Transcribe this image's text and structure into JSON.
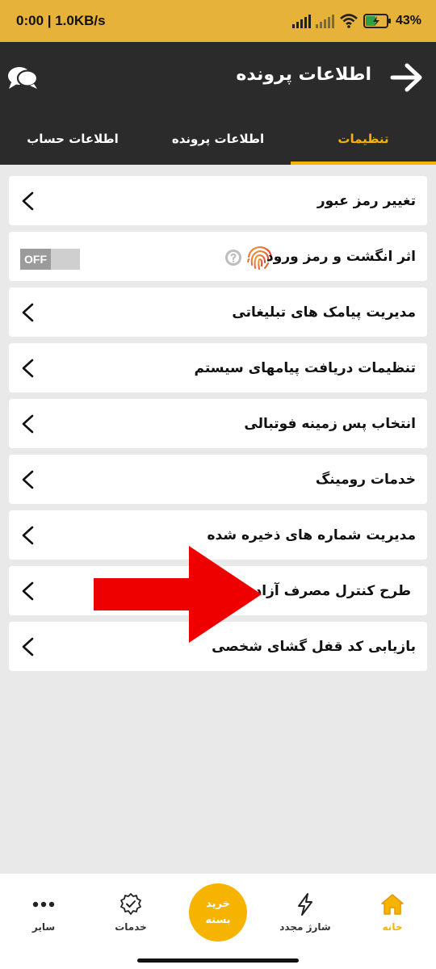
{
  "status_bar": {
    "time_speed": "0:00 | 1.0KB/s",
    "battery": "43%"
  },
  "app_bar": {
    "title": "اطلاعات پرونده"
  },
  "tabs": [
    {
      "label": "تنظیمات",
      "active": true
    },
    {
      "label": "اطلاعات پرونده",
      "active": false
    },
    {
      "label": "اطلاعات حساب",
      "active": false
    }
  ],
  "settings": {
    "items": [
      {
        "label": "تغییر رمز عبور"
      },
      {
        "label": "اثر انگشت و رمز ورود",
        "toggle": "OFF"
      },
      {
        "label": "مدیریت پیامک های تبلیغاتی"
      },
      {
        "label": "تنظیمات دریافت پیامهای سیستم"
      },
      {
        "label": "انتخاب پس زمینه فوتبالی"
      },
      {
        "label": "خدمات رومینگ"
      },
      {
        "label": "مدیریت شماره های ذخیره شده"
      },
      {
        "label": "طرح کنترل مصرف آزاد"
      },
      {
        "label": "بازیابی کد قفل گشای شخصی"
      }
    ]
  },
  "bottom_nav": {
    "home": "خانه",
    "recharge": "شارژ مجدد",
    "buy_line1": "خرید",
    "buy_line2": "بسته",
    "services": "خدمات",
    "more": "سایر"
  },
  "colors": {
    "accent": "#f6b400",
    "status_bar": "#e7b23a",
    "header": "#2b2b2b",
    "arrow": "#ee0000"
  }
}
